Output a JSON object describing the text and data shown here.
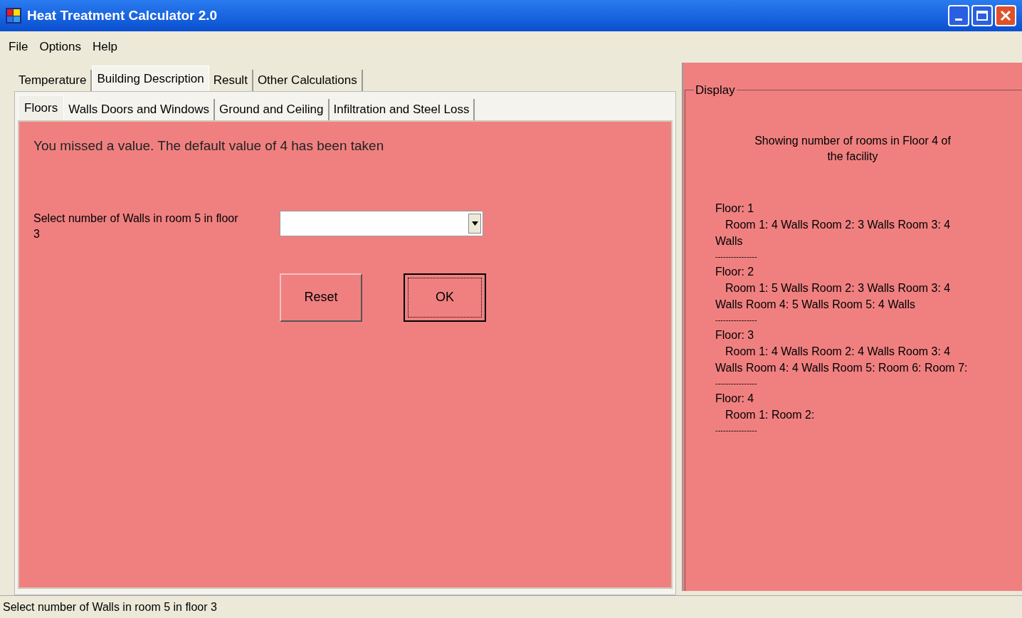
{
  "window": {
    "title": "Heat Treatment Calculator 2.0"
  },
  "menu": [
    "File",
    "Options",
    "Help"
  ],
  "tabs": [
    {
      "label": "Temperature",
      "selected": false
    },
    {
      "label": "Building Description",
      "selected": true
    },
    {
      "label": "Result",
      "selected": false
    },
    {
      "label": "Other Calculations",
      "selected": false
    }
  ],
  "subtabs": [
    {
      "label": "Floors",
      "selected": true
    },
    {
      "label": "Walls Doors and Windows",
      "selected": false
    },
    {
      "label": "Ground and Ceiling",
      "selected": false
    },
    {
      "label": "Infiltration and Steel Loss",
      "selected": false
    }
  ],
  "message": "You missed a value. The default value of 4 has been taken",
  "walls_field": {
    "label_lines": [
      "Select number of Walls in room 5 in floor",
      "3"
    ]
  },
  "buttons": [
    {
      "label": "Reset",
      "focused": false
    },
    {
      "label": "OK",
      "focused": true
    }
  ],
  "display": {
    "title": "Display",
    "heading_lines": [
      "Showing number of rooms in Floor 4 of",
      "the facility"
    ],
    "floors": [
      {
        "floor": "Floor: 1",
        "lines": [
          "Room 1: 4 Walls Room 2: 3 Walls Room 3: 4",
          "Walls"
        ],
        "separator": "----------------"
      },
      {
        "floor": "Floor: 2",
        "lines": [
          "Room 1: 5 Walls Room 2: 3 Walls Room 3: 4",
          "Walls Room 4: 5 Walls Room 5: 4 Walls"
        ],
        "separator": "----------------"
      },
      {
        "floor": "Floor: 3",
        "lines": [
          "Room 1: 4 Walls Room 2: 4 Walls Room 3: 4",
          "Walls Room 4: 4 Walls Room 5: Room 6: Room 7:"
        ],
        "separator": "----------------"
      },
      {
        "floor": "Floor: 4",
        "lines": [
          "Room 1: Room 2:"
        ],
        "separator": "----------------"
      }
    ]
  },
  "status_bar": "Select number of Walls in room 5 in floor 3"
}
